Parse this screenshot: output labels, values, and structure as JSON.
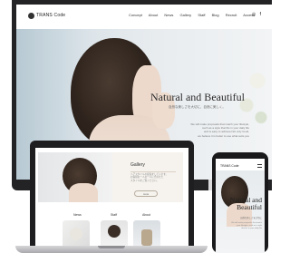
{
  "brand": {
    "name": "TRANS Code"
  },
  "desktop": {
    "nav": [
      "Concept",
      "About",
      "News",
      "Gallery",
      "Staff",
      "Blog",
      "Recruit",
      "Access"
    ],
    "socials": [
      "◎",
      "f"
    ],
    "hero": {
      "title": "Natural and Beautiful",
      "subtitle": "自然な美しさを大切に、自然に美しく。",
      "text": [
        "We will make proposals that match your lifestyle,",
        "such as a style that fits in your daily life",
        "and is easy to achieve.Not only trend,",
        "we believe it is better to use what suits you"
      ]
    }
  },
  "laptop": {
    "gallery": {
      "title": "Gallery",
      "desc": [
        "ヘアスタイルの提案をしています。",
        "お客様お一人お一人に合わせた",
        "スタイルをご覧ください。"
      ],
      "button": "more"
    },
    "sections": [
      "News",
      "Staff",
      "About"
    ]
  },
  "phone": {
    "logo": "TRANS Code",
    "hero_title_line1": "Natural and",
    "hero_title_line2": "Beautiful",
    "hero_sub": "自然な美しさを大切に",
    "hero_text": [
      "We will make proposals that match",
      "your lifestyle, such as a style",
      "that fits in your daily life"
    ]
  },
  "colors": {
    "frame": "#232326",
    "accent": "#b8ada0",
    "hero_bg": "#dde5ea"
  }
}
